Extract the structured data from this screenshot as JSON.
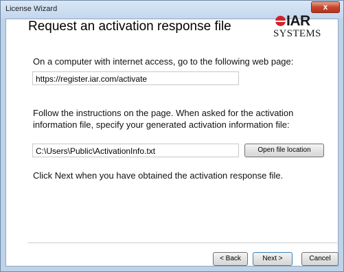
{
  "window": {
    "title": "License Wizard",
    "close_glyph": "x"
  },
  "header": {
    "heading": "Request an activation response file"
  },
  "logo": {
    "iar": "IAR",
    "systems": "SYSTEMS",
    "colors": {
      "dot": "#d2232a",
      "text": "#1a1a1a"
    }
  },
  "step1": {
    "instruction": "On a computer with internet access, go to the following web page:",
    "url": "https://register.iar.com/activate"
  },
  "step2": {
    "instruction": "Follow the instructions on the page. When asked for the activation information file, specify your generated activation information file:",
    "file_path": "C:\\Users\\Public\\ActivationInfo.txt",
    "open_button": "Open file location"
  },
  "step3": {
    "instruction": "Click Next when you have obtained the activation response file."
  },
  "footer": {
    "back": "< Back",
    "next": "Next >",
    "cancel": "Cancel"
  },
  "colors": {
    "titlebar": "#c3d7ee",
    "close": "#c7462c",
    "accent": "#3c7fb1"
  }
}
